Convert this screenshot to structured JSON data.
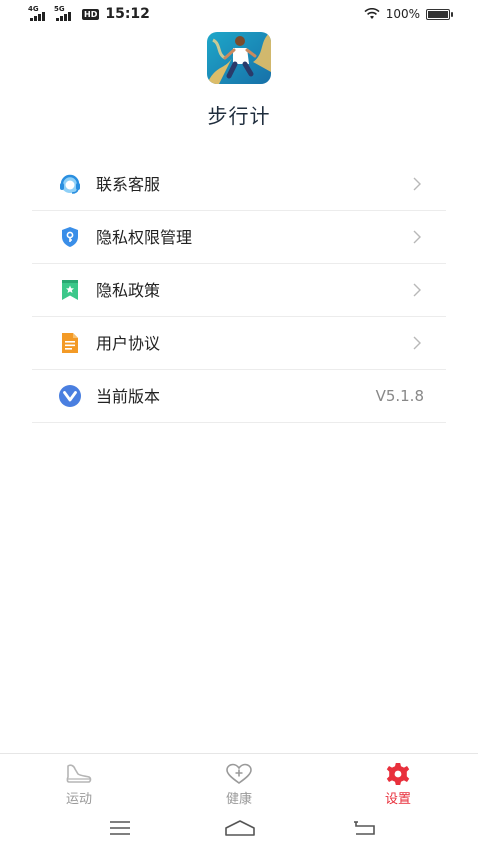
{
  "status_bar": {
    "network_1": "4G",
    "network_2": "5G",
    "hd": "HD",
    "time": "15:12",
    "battery": "100%"
  },
  "header": {
    "app_name": "步行计",
    "logo_icon": "runner-logo-icon"
  },
  "menu": {
    "items": [
      {
        "label": "联系客服",
        "icon": "headset-icon",
        "color": "#3a9ee8",
        "chevron": true
      },
      {
        "label": "隐私权限管理",
        "icon": "shield-key-icon",
        "color": "#3a8ee8",
        "chevron": true
      },
      {
        "label": "隐私政策",
        "icon": "bookmark-star-icon",
        "color": "#3cc88a",
        "chevron": true
      },
      {
        "label": "用户协议",
        "icon": "document-icon",
        "color": "#f39a26",
        "chevron": true
      },
      {
        "label": "当前版本",
        "icon": "version-v-icon",
        "color": "#4a7fe0",
        "value": "V5.1.8"
      }
    ]
  },
  "bottom_nav": {
    "tabs": [
      {
        "label": "运动",
        "icon": "shoe-icon",
        "active": false
      },
      {
        "label": "健康",
        "icon": "heart-plus-icon",
        "active": false
      },
      {
        "label": "设置",
        "icon": "gear-icon",
        "active": true
      }
    ],
    "active_color": "#e8303c",
    "inactive_color": "#9a9a9a"
  },
  "system_nav": {
    "buttons": [
      "menu-icon",
      "home-icon",
      "back-icon"
    ]
  }
}
